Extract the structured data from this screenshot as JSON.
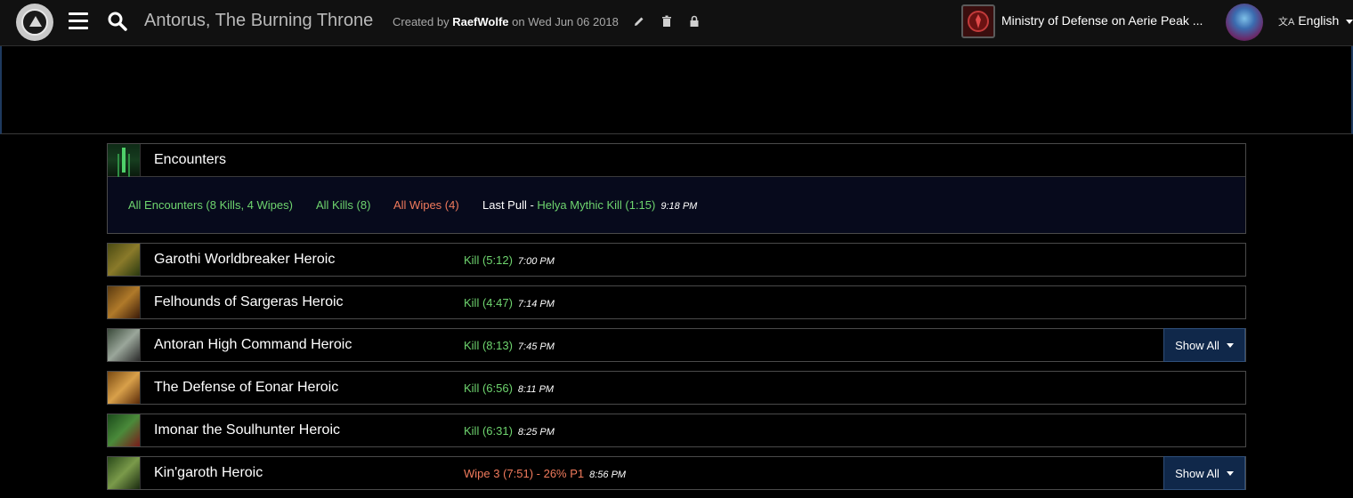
{
  "header": {
    "title": "Antorus, The Burning Throne",
    "created_prefix": "Created by ",
    "created_author": "RaefWolfe",
    "created_suffix": " on Wed Jun 06 2018",
    "guild_name": "Ministry of Defense on Aerie Peak ...",
    "language": "English"
  },
  "panel": {
    "title": "Encounters",
    "filters": {
      "all_encounters": "All Encounters (8 Kills, 4 Wipes)",
      "all_kills": "All Kills (8)",
      "all_wipes": "All Wipes (4)",
      "last_pull_label": "Last Pull - ",
      "last_pull_value": "Helya Mythic Kill (1:15)",
      "last_pull_time": "9:18 PM"
    }
  },
  "encounters": [
    {
      "name": "Garothi Worldbreaker Heroic",
      "result": "Kill (5:12)",
      "status": "kill",
      "time": "7:00 PM",
      "show_all": null
    },
    {
      "name": "Felhounds of Sargeras Heroic",
      "result": "Kill (4:47)",
      "status": "kill",
      "time": "7:14 PM",
      "show_all": null
    },
    {
      "name": "Antoran High Command Heroic",
      "result": "Kill (8:13)",
      "status": "kill",
      "time": "7:45 PM",
      "show_all": "Show All"
    },
    {
      "name": "The Defense of Eonar Heroic",
      "result": "Kill (6:56)",
      "status": "kill",
      "time": "8:11 PM",
      "show_all": null
    },
    {
      "name": "Imonar the Soulhunter Heroic",
      "result": "Kill (6:31)",
      "status": "kill",
      "time": "8:25 PM",
      "show_all": null
    },
    {
      "name": "Kin'garoth Heroic",
      "result": "Wipe 3 (7:51) - 26% P1",
      "status": "wipe",
      "time": "8:56 PM",
      "show_all": "Show All"
    }
  ],
  "colors": {
    "kill": "#6ed46e",
    "wipe": "#f07a5c",
    "show_all_bg": "#10284a"
  }
}
